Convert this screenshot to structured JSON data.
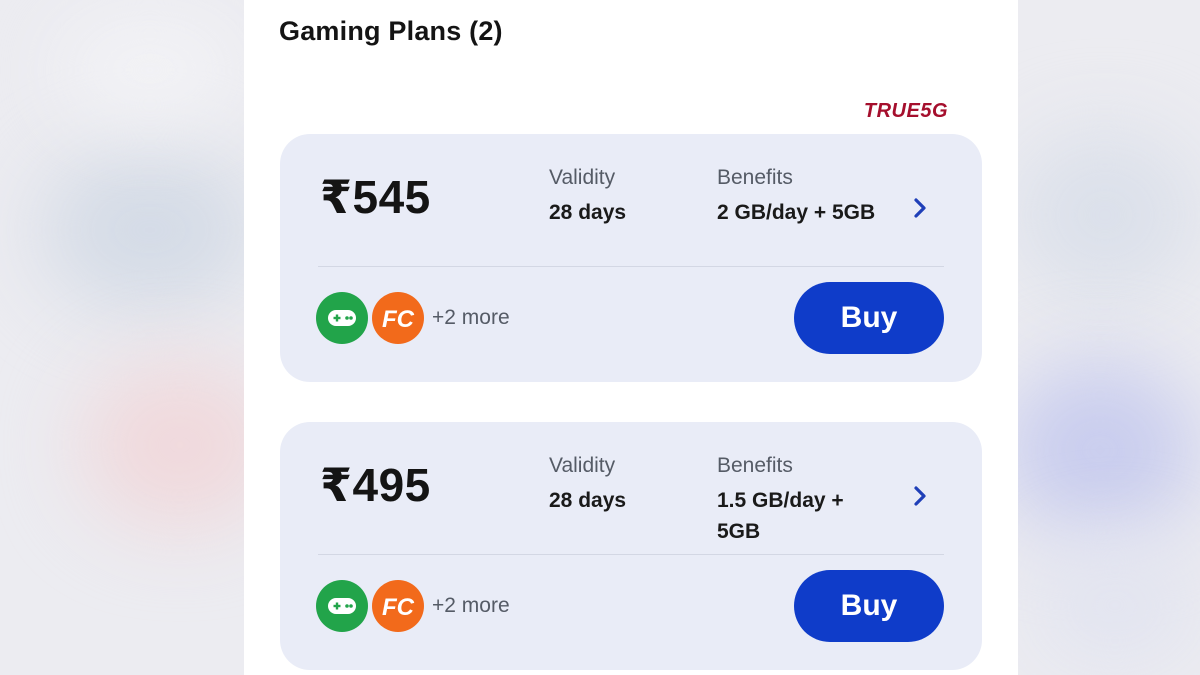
{
  "section": {
    "title": "Gaming Plans (2)"
  },
  "badge": {
    "text": "TRUE5G",
    "color": "#a50f2d"
  },
  "plans": [
    {
      "price": "₹545",
      "validity_label": "Validity",
      "validity_value": "28 days",
      "benefits_label": "Benefits",
      "benefits_value": "2 GB/day + 5GB",
      "app_icons": [
        "gamepad-icon",
        "fc-icon"
      ],
      "more_text": "+2 more",
      "buy_label": "Buy"
    },
    {
      "price": "₹495",
      "validity_label": "Validity",
      "validity_value": "28 days",
      "benefits_label": "Benefits",
      "benefits_value": "1.5 GB/day + 5GB",
      "app_icons": [
        "gamepad-icon",
        "fc-icon"
      ],
      "more_text": "+2 more",
      "buy_label": "Buy"
    }
  ],
  "colors": {
    "accent": "#0f3cc9",
    "card_background": "#e9ecf7",
    "gamepad_icon": "#22a44a",
    "fc_icon": "#f26a1b"
  },
  "icons": {
    "fc_letters": "FC"
  }
}
